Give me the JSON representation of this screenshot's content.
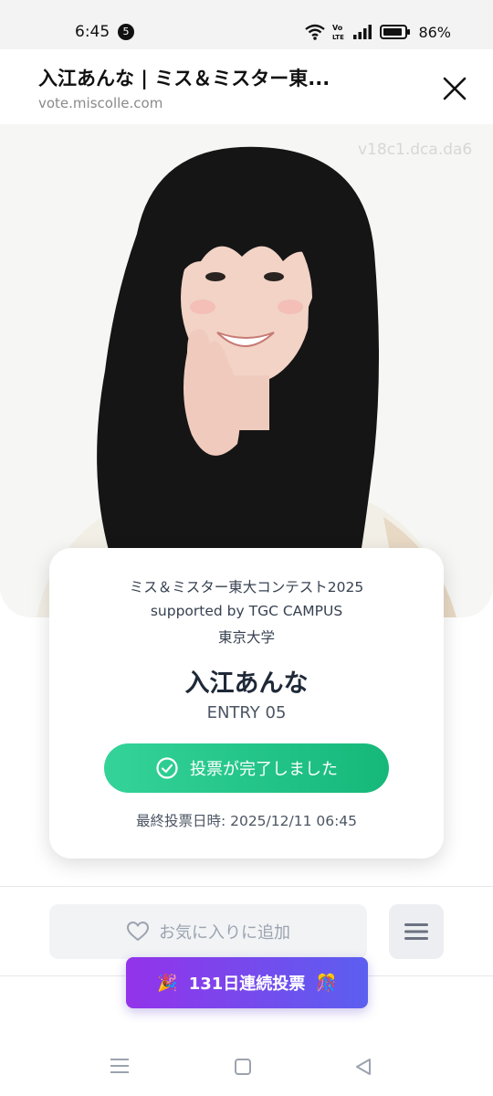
{
  "status_bar": {
    "time": "6:45",
    "notification_count": "5",
    "network_label": "Vo LTE",
    "battery": "86%"
  },
  "header": {
    "title": "入江あんな | ミス＆ミスター東...",
    "url": "vote.miscolle.com",
    "close_icon": "close-icon"
  },
  "photo": {
    "watermark": "v18c1.dca.da6"
  },
  "card": {
    "contest_line1": "ミス＆ミスター東大コンテスト2025",
    "contest_line2": "supported by TGC CAMPUS",
    "university": "東京大学",
    "name": "入江あんな",
    "entry": "ENTRY 05",
    "vote_done_label": "投票が完了しました",
    "last_vote": "最終投票日時: 2025/12/11 06:45"
  },
  "actions": {
    "favorite_label": "お気に入りに追加",
    "menu_icon": "hamburger-icon"
  },
  "streak": {
    "label": "131日連続投票",
    "left_emoji": "🎉",
    "right_emoji": "🎊"
  },
  "colors": {
    "vote_done": "#22c58a",
    "streak_start": "#9333ea",
    "streak_end": "#5b5ff0"
  }
}
